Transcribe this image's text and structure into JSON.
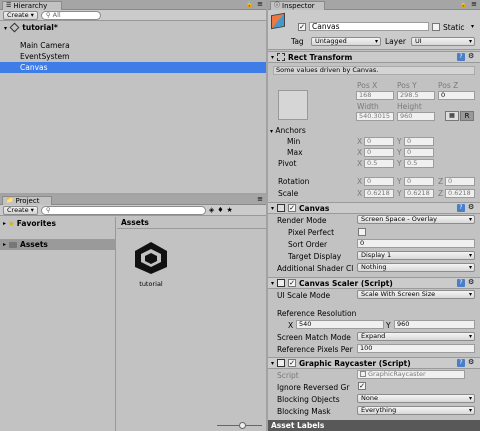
{
  "hierarchy": {
    "tab": "Hierarchy",
    "create": "Create",
    "search_placeholder": "All",
    "scene": "tutorial*",
    "items": [
      "Main Camera",
      "EventSystem",
      "Canvas"
    ]
  },
  "project": {
    "tab": "Project",
    "create": "Create",
    "favorites": "Favorites",
    "assets_folder": "Assets",
    "assets_header": "Assets",
    "asset_name": "tutorial"
  },
  "inspector": {
    "tab": "Inspector",
    "object_name": "Canvas",
    "static_label": "Static",
    "tag_label": "Tag",
    "tag_value": "Untagged",
    "layer_label": "Layer",
    "layer_value": "UI",
    "rect": {
      "title": "Rect Transform",
      "note": "Some values driven by Canvas.",
      "pos_x_label": "Pos X",
      "pos_y_label": "Pos Y",
      "pos_z_label": "Pos Z",
      "pos_x": "168",
      "pos_y": "298.5",
      "pos_z": "0",
      "width_label": "Width",
      "height_label": "Height",
      "width": "540.3015",
      "height": "960",
      "r_button": "R",
      "anchors": "Anchors",
      "min": "Min",
      "max": "Max",
      "min_x": "0",
      "min_y": "0",
      "max_x": "0",
      "max_y": "0",
      "pivot": "Pivot",
      "pivot_x": "0.5",
      "pivot_y": "0.5",
      "rotation": "Rotation",
      "rot_x": "0",
      "rot_y": "0",
      "rot_z": "0",
      "scale": "Scale",
      "scale_x": "0.6218",
      "scale_y": "0.6218",
      "scale_z": "0.6218",
      "x": "X",
      "y": "Y",
      "z": "Z"
    },
    "canvas": {
      "title": "Canvas",
      "render_mode_label": "Render Mode",
      "render_mode": "Screen Space - Overlay",
      "pixel_perfect": "Pixel Perfect",
      "sort_order_label": "Sort Order",
      "sort_order": "0",
      "target_display_label": "Target Display",
      "target_display": "Display 1",
      "shader_label": "Additional Shader Cl",
      "shader": "Nothing"
    },
    "scaler": {
      "title": "Canvas Scaler (Script)",
      "ui_scale_label": "UI Scale Mode",
      "ui_scale": "Scale With Screen Size",
      "ref_res_label": "Reference Resolution",
      "x": "X",
      "y": "Y",
      "res_x": "540",
      "res_y": "960",
      "match_label": "Screen Match Mode",
      "match": "Expand",
      "ppu_label": "Reference Pixels Per",
      "ppu": "100"
    },
    "raycaster": {
      "title": "Graphic Raycaster (Script)",
      "script_label": "Script",
      "script": "GraphicRaycaster",
      "ignore_label": "Ignore Reversed Gr",
      "blocking_objects_label": "Blocking Objects",
      "blocking_objects": "None",
      "blocking_mask_label": "Blocking Mask",
      "blocking_mask": "Everything"
    },
    "asset_labels": "Asset Labels"
  },
  "colors": {
    "selection": "#3e7de7",
    "panel": "#c2c2c2"
  }
}
